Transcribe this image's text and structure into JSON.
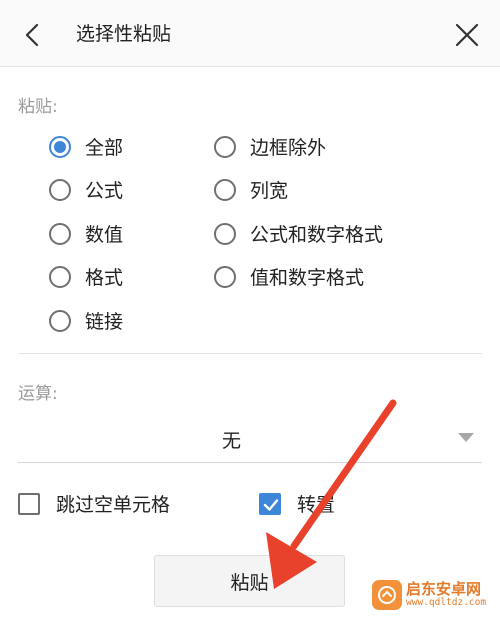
{
  "header": {
    "title": "选择性粘贴",
    "back_icon": "chevron-left-icon",
    "close_icon": "close-icon"
  },
  "paste_section": {
    "label": "粘贴:",
    "selected": "全部",
    "options": [
      {
        "label": "全部",
        "checked": true
      },
      {
        "label": "边框除外",
        "checked": false
      },
      {
        "label": "公式",
        "checked": false
      },
      {
        "label": "列宽",
        "checked": false
      },
      {
        "label": "数值",
        "checked": false
      },
      {
        "label": "公式和数字格式",
        "checked": false
      },
      {
        "label": "格式",
        "checked": false
      },
      {
        "label": "值和数字格式",
        "checked": false
      },
      {
        "label": "链接",
        "checked": false
      }
    ]
  },
  "operation_section": {
    "label": "运算:",
    "selected_value": "无",
    "dropdown_icon": "caret-down-icon"
  },
  "toggles": {
    "skip_blanks": {
      "label": "跳过空单元格",
      "checked": false
    },
    "transpose": {
      "label": "转置",
      "checked": true
    }
  },
  "paste_button": {
    "label": "粘贴"
  },
  "annotation": {
    "type": "red-arrow",
    "color": "#e8412c",
    "points_to": "paste-button"
  },
  "watermark": {
    "name": "启东安卓网",
    "url": "www.qdltdz.com",
    "color": "#e57a2a"
  },
  "colors": {
    "accent": "#3d86d8",
    "header_bg": "#fafafa",
    "divider": "#e4e4e4"
  }
}
